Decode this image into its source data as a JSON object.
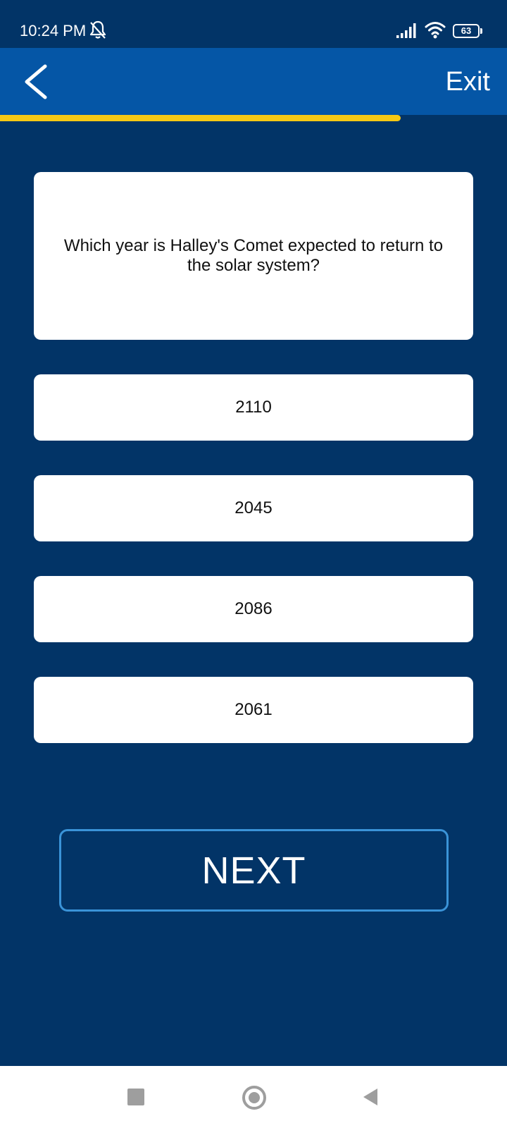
{
  "status_bar": {
    "time": "10:24 PM",
    "battery_level": "63",
    "battery_fraction": 0.63,
    "icons": [
      "bell-off-icon",
      "signal-icon",
      "wifi-icon",
      "battery-icon"
    ]
  },
  "app_bar": {
    "back_icon": "chevron-left-icon",
    "exit_label": "Exit",
    "background": "#0556a6"
  },
  "progress": {
    "fraction": 0.79,
    "color": "#f6c814"
  },
  "question": {
    "text": "Which year is Halley's Comet expected to return to the solar system?"
  },
  "options": [
    {
      "label": "2110"
    },
    {
      "label": "2045"
    },
    {
      "label": "2086"
    },
    {
      "label": "2061"
    }
  ],
  "next_button": {
    "label": "NEXT",
    "border_color": "#3a93d8"
  },
  "nav_bar": {
    "icons": [
      "recent-apps-icon",
      "home-icon",
      "back-triangle-icon"
    ]
  },
  "colors": {
    "background": "#023467",
    "card": "#ffffff"
  }
}
